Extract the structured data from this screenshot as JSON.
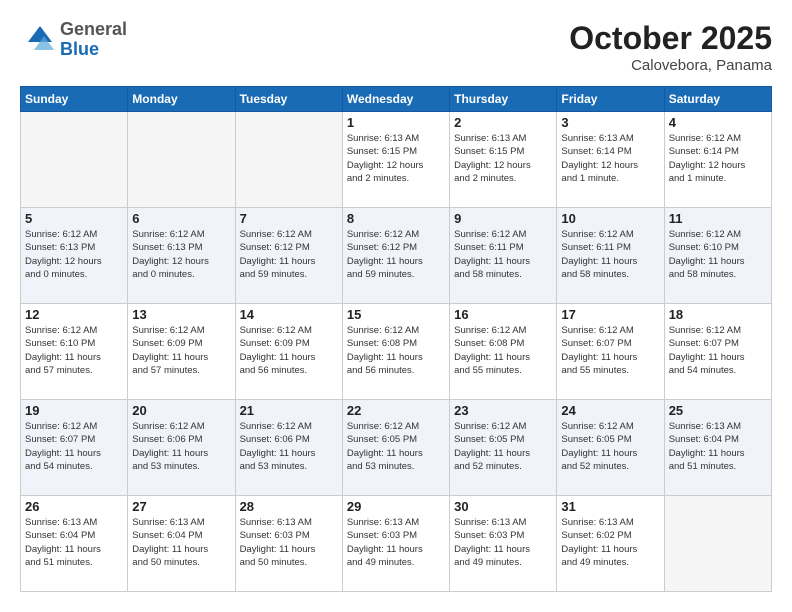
{
  "header": {
    "logo_general": "General",
    "logo_blue": "Blue",
    "month": "October 2025",
    "location": "Calovebora, Panama"
  },
  "weekdays": [
    "Sunday",
    "Monday",
    "Tuesday",
    "Wednesday",
    "Thursday",
    "Friday",
    "Saturday"
  ],
  "weeks": [
    [
      {
        "day": "",
        "info": ""
      },
      {
        "day": "",
        "info": ""
      },
      {
        "day": "",
        "info": ""
      },
      {
        "day": "1",
        "info": "Sunrise: 6:13 AM\nSunset: 6:15 PM\nDaylight: 12 hours\nand 2 minutes."
      },
      {
        "day": "2",
        "info": "Sunrise: 6:13 AM\nSunset: 6:15 PM\nDaylight: 12 hours\nand 2 minutes."
      },
      {
        "day": "3",
        "info": "Sunrise: 6:13 AM\nSunset: 6:14 PM\nDaylight: 12 hours\nand 1 minute."
      },
      {
        "day": "4",
        "info": "Sunrise: 6:12 AM\nSunset: 6:14 PM\nDaylight: 12 hours\nand 1 minute."
      }
    ],
    [
      {
        "day": "5",
        "info": "Sunrise: 6:12 AM\nSunset: 6:13 PM\nDaylight: 12 hours\nand 0 minutes."
      },
      {
        "day": "6",
        "info": "Sunrise: 6:12 AM\nSunset: 6:13 PM\nDaylight: 12 hours\nand 0 minutes."
      },
      {
        "day": "7",
        "info": "Sunrise: 6:12 AM\nSunset: 6:12 PM\nDaylight: 11 hours\nand 59 minutes."
      },
      {
        "day": "8",
        "info": "Sunrise: 6:12 AM\nSunset: 6:12 PM\nDaylight: 11 hours\nand 59 minutes."
      },
      {
        "day": "9",
        "info": "Sunrise: 6:12 AM\nSunset: 6:11 PM\nDaylight: 11 hours\nand 58 minutes."
      },
      {
        "day": "10",
        "info": "Sunrise: 6:12 AM\nSunset: 6:11 PM\nDaylight: 11 hours\nand 58 minutes."
      },
      {
        "day": "11",
        "info": "Sunrise: 6:12 AM\nSunset: 6:10 PM\nDaylight: 11 hours\nand 58 minutes."
      }
    ],
    [
      {
        "day": "12",
        "info": "Sunrise: 6:12 AM\nSunset: 6:10 PM\nDaylight: 11 hours\nand 57 minutes."
      },
      {
        "day": "13",
        "info": "Sunrise: 6:12 AM\nSunset: 6:09 PM\nDaylight: 11 hours\nand 57 minutes."
      },
      {
        "day": "14",
        "info": "Sunrise: 6:12 AM\nSunset: 6:09 PM\nDaylight: 11 hours\nand 56 minutes."
      },
      {
        "day": "15",
        "info": "Sunrise: 6:12 AM\nSunset: 6:08 PM\nDaylight: 11 hours\nand 56 minutes."
      },
      {
        "day": "16",
        "info": "Sunrise: 6:12 AM\nSunset: 6:08 PM\nDaylight: 11 hours\nand 55 minutes."
      },
      {
        "day": "17",
        "info": "Sunrise: 6:12 AM\nSunset: 6:07 PM\nDaylight: 11 hours\nand 55 minutes."
      },
      {
        "day": "18",
        "info": "Sunrise: 6:12 AM\nSunset: 6:07 PM\nDaylight: 11 hours\nand 54 minutes."
      }
    ],
    [
      {
        "day": "19",
        "info": "Sunrise: 6:12 AM\nSunset: 6:07 PM\nDaylight: 11 hours\nand 54 minutes."
      },
      {
        "day": "20",
        "info": "Sunrise: 6:12 AM\nSunset: 6:06 PM\nDaylight: 11 hours\nand 53 minutes."
      },
      {
        "day": "21",
        "info": "Sunrise: 6:12 AM\nSunset: 6:06 PM\nDaylight: 11 hours\nand 53 minutes."
      },
      {
        "day": "22",
        "info": "Sunrise: 6:12 AM\nSunset: 6:05 PM\nDaylight: 11 hours\nand 53 minutes."
      },
      {
        "day": "23",
        "info": "Sunrise: 6:12 AM\nSunset: 6:05 PM\nDaylight: 11 hours\nand 52 minutes."
      },
      {
        "day": "24",
        "info": "Sunrise: 6:12 AM\nSunset: 6:05 PM\nDaylight: 11 hours\nand 52 minutes."
      },
      {
        "day": "25",
        "info": "Sunrise: 6:13 AM\nSunset: 6:04 PM\nDaylight: 11 hours\nand 51 minutes."
      }
    ],
    [
      {
        "day": "26",
        "info": "Sunrise: 6:13 AM\nSunset: 6:04 PM\nDaylight: 11 hours\nand 51 minutes."
      },
      {
        "day": "27",
        "info": "Sunrise: 6:13 AM\nSunset: 6:04 PM\nDaylight: 11 hours\nand 50 minutes."
      },
      {
        "day": "28",
        "info": "Sunrise: 6:13 AM\nSunset: 6:03 PM\nDaylight: 11 hours\nand 50 minutes."
      },
      {
        "day": "29",
        "info": "Sunrise: 6:13 AM\nSunset: 6:03 PM\nDaylight: 11 hours\nand 49 minutes."
      },
      {
        "day": "30",
        "info": "Sunrise: 6:13 AM\nSunset: 6:03 PM\nDaylight: 11 hours\nand 49 minutes."
      },
      {
        "day": "31",
        "info": "Sunrise: 6:13 AM\nSunset: 6:02 PM\nDaylight: 11 hours\nand 49 minutes."
      },
      {
        "day": "",
        "info": ""
      }
    ]
  ]
}
